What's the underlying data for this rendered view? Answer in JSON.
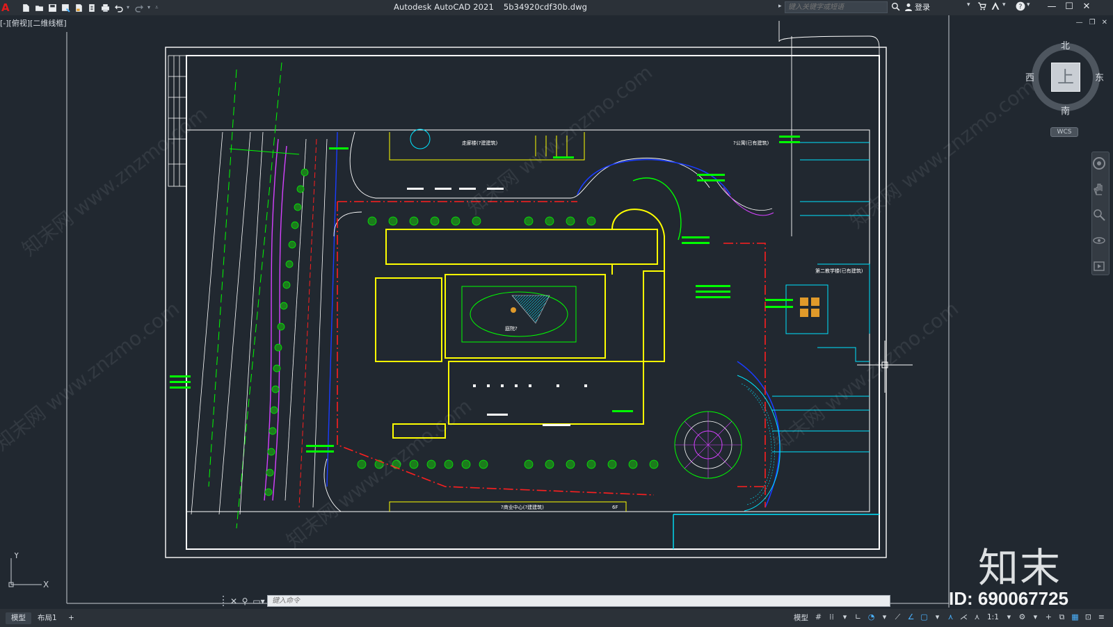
{
  "titlebar": {
    "app_logo": "A",
    "app_name": "Autodesk AutoCAD 2021",
    "file_name": "5b34920cdf30b.dwg",
    "search_placeholder": "键入关键字或短语",
    "login_label": "登录",
    "quick_access": [
      "new-icon",
      "open-icon",
      "save-icon",
      "saveas-icon",
      "plot-preview-icon",
      "publish-icon",
      "print-icon",
      "undo-icon",
      "redo-icon"
    ]
  },
  "viewport": {
    "label": "[-][俯视][二维线框]"
  },
  "viewcube": {
    "north": "北",
    "south": "南",
    "west": "西",
    "east": "东",
    "face": "上",
    "wcs": "WCS"
  },
  "ucs": {
    "x": "X",
    "y": "Y"
  },
  "drawing_labels": {
    "top_building": "走廊楼(?建建筑)",
    "top_right_building": "?公寓(已有建筑)",
    "right_building": "第二教学楼(已有建筑)",
    "bottom_building": "?商业中心(?建建筑)",
    "courtyard": "庭院?",
    "floors": "6F"
  },
  "command": {
    "placeholder": "键入命令"
  },
  "status": {
    "tabs": [
      "模型",
      "布局1"
    ],
    "add_tab": "+",
    "model_label": "模型",
    "scale": "1:1"
  },
  "watermark": {
    "logo": "知末",
    "id": "ID: 690067725",
    "tile_text": "知末网 www.znzmo.com"
  },
  "colors": {
    "background": "#212830",
    "yellow": "#ffff00",
    "green": "#00ff00",
    "red": "#ff1f1f",
    "cyan": "#00e5ff",
    "magenta": "#d542ff",
    "white": "#ffffff"
  }
}
